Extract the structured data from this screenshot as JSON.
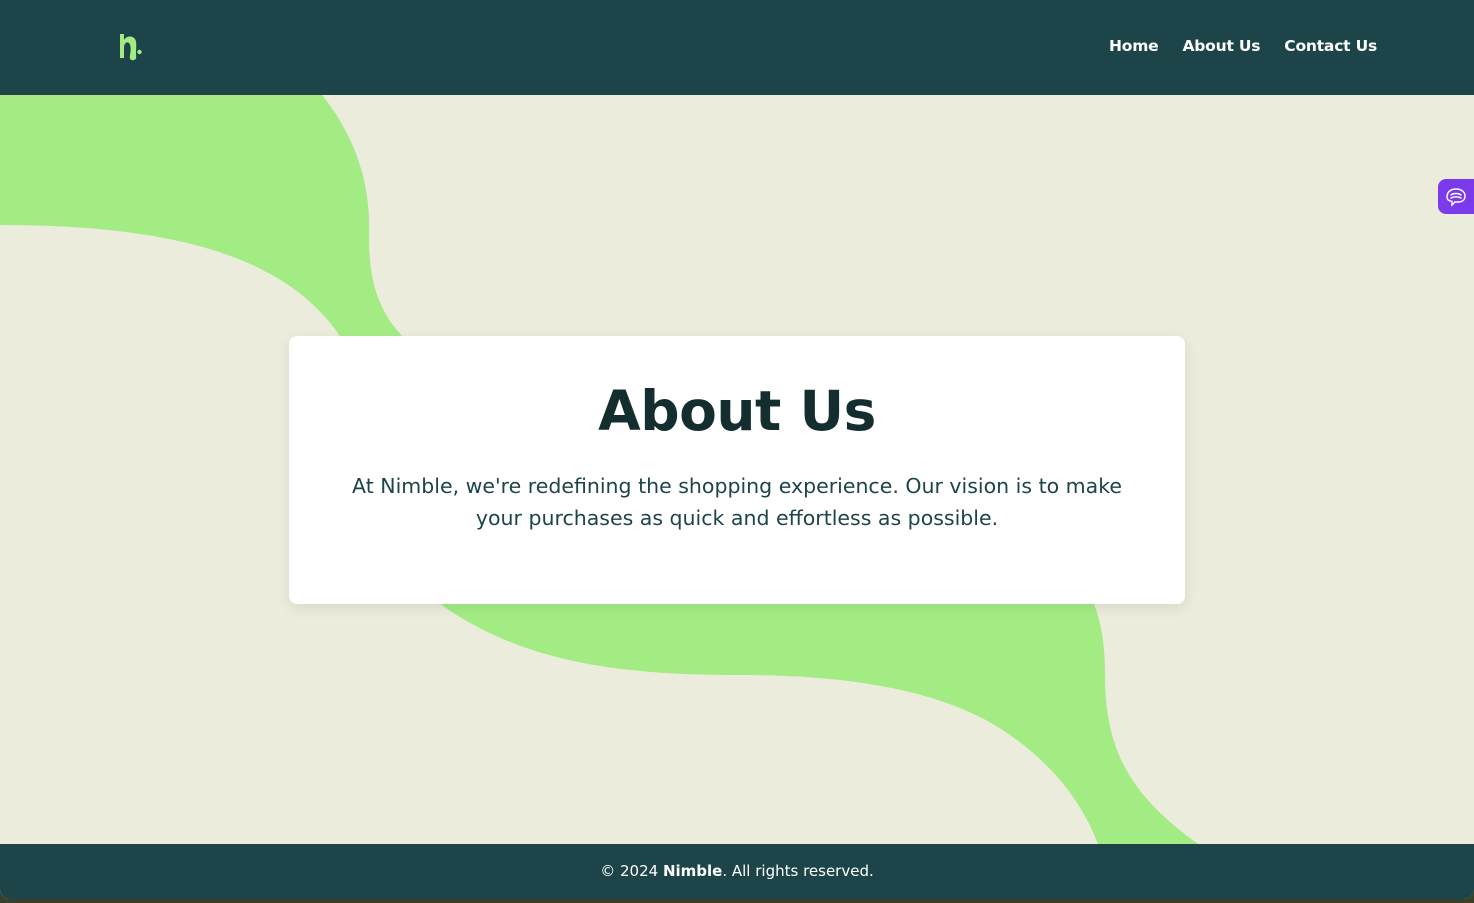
{
  "header": {
    "logo_icon": "nimble-n-logo-icon",
    "nav": [
      {
        "label": "Home"
      },
      {
        "label": "About Us"
      },
      {
        "label": "Contact Us"
      }
    ]
  },
  "main": {
    "title": "About Us",
    "description": "At Nimble, we're redefining the shopping experience. Our vision is to make your purchases as quick and effortless as possible."
  },
  "footer": {
    "prefix": "© 2024 ",
    "brand": "Nimble",
    "suffix": ". All rights reserved."
  },
  "widget": {
    "icon": "brain-icon",
    "color": "#7c3aed"
  },
  "colors": {
    "header_bg": "#1d4549",
    "page_bg": "#ebecdb",
    "accent_green": "#a3ec84",
    "title": "#142e30"
  }
}
